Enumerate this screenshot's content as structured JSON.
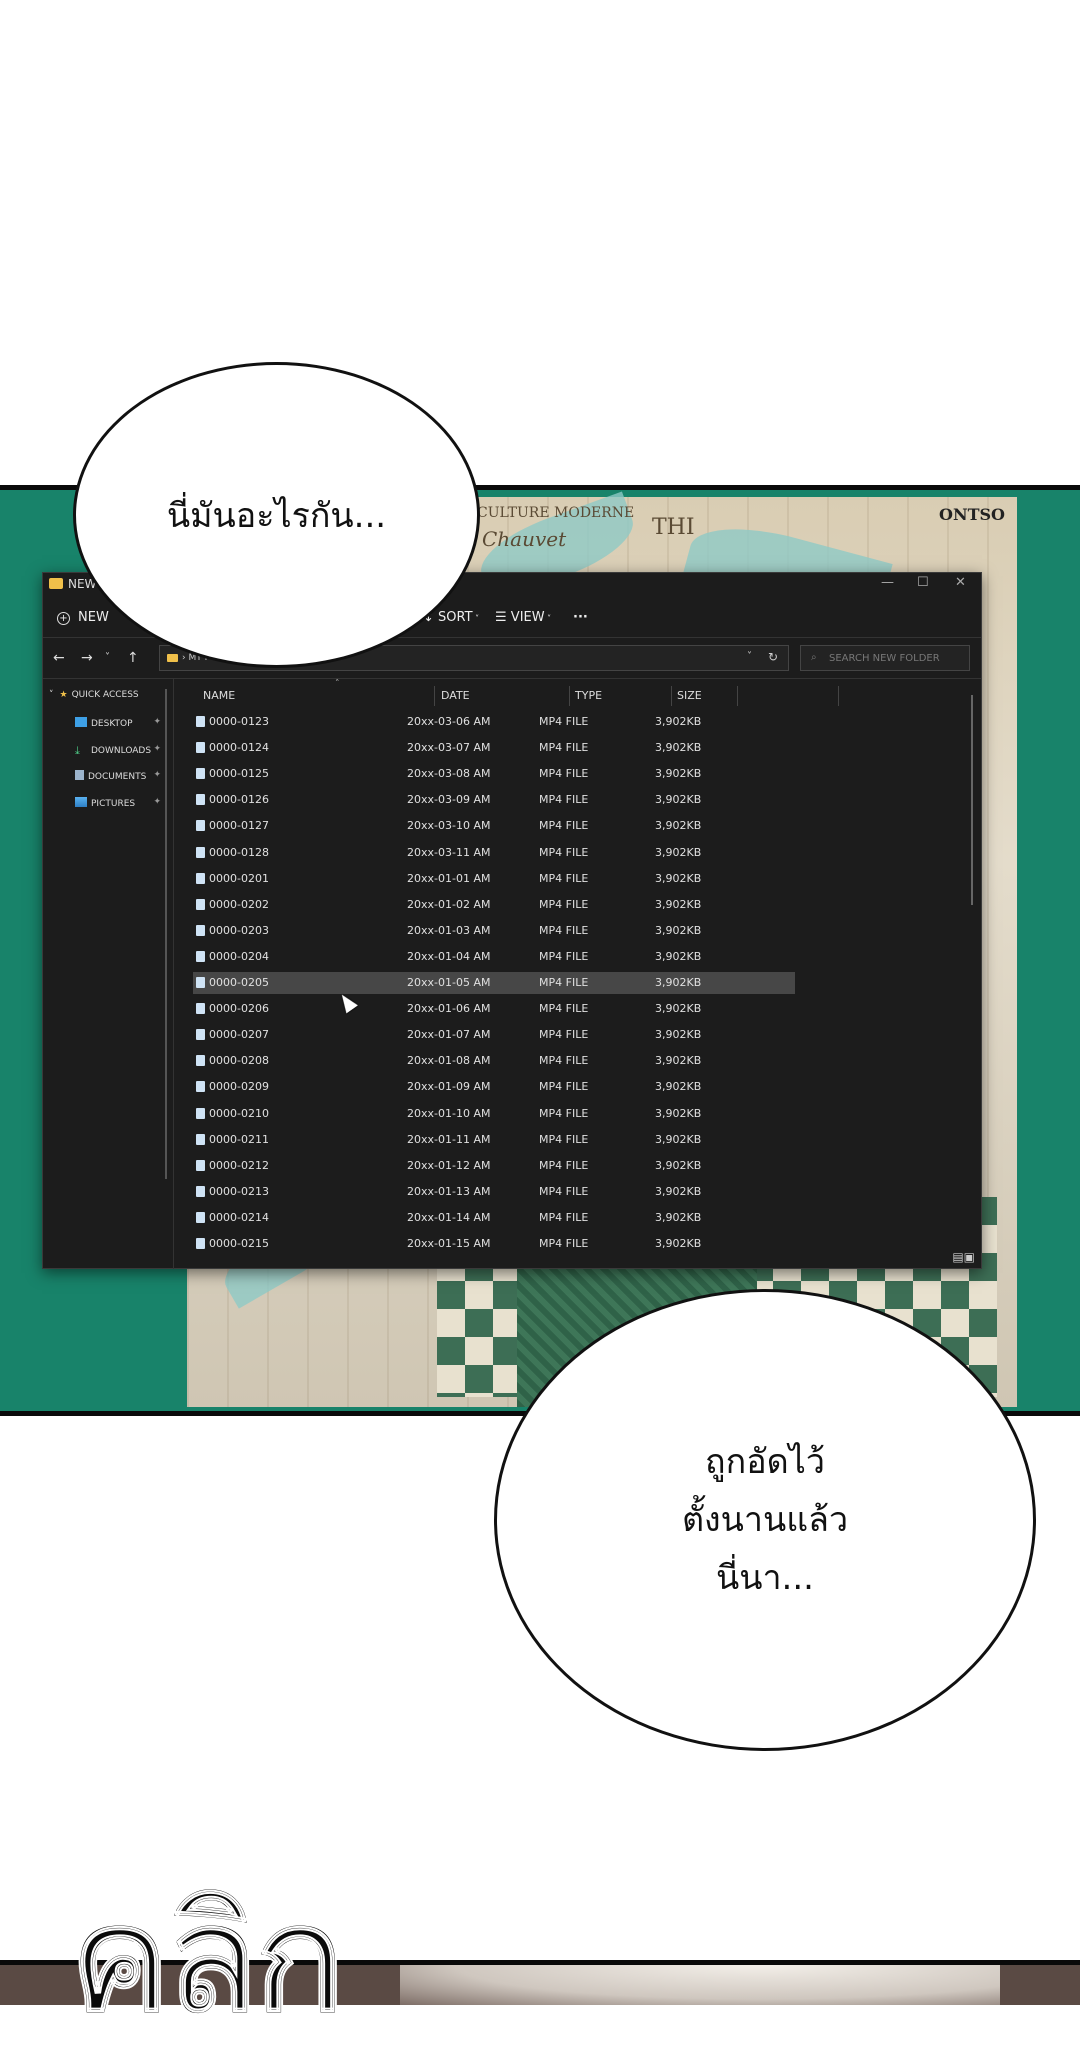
{
  "bubbles": {
    "top": "นี่มันอะไรกัน...",
    "bottom": "ถูกอัดไว้\nตั้งนานแล้ว\nนี่นา..."
  },
  "sfx": "คลิก",
  "background_art": {
    "text1": "CULTURE MODERNE",
    "text2": "Chauvet",
    "text3": "THI",
    "text4": "ONTSO"
  },
  "explorer": {
    "title": "NEW",
    "window_controls": [
      "—",
      "☐",
      "✕"
    ],
    "toolbar": {
      "new": "NEW",
      "sort": "SORT",
      "view": "VIEW",
      "more": "···"
    },
    "address": {
      "folder_icon": "folder-icon",
      "path": "› MY PC ›"
    },
    "search_placeholder": "SEARCH NEW FOLDER",
    "sidebar": {
      "quick_access": "QUICK ACCESS",
      "items": [
        "DESKTOP",
        "DOWNLOADS",
        "DOCUMENTS",
        "PICTURES"
      ]
    },
    "columns": [
      "NAME",
      "DATE",
      "TYPE",
      "SIZE"
    ],
    "selected_row": "0000-0205",
    "files": [
      {
        "name": "0000-0123",
        "date": "20xx-03-06 AM",
        "type": "MP4 FILE",
        "size": "3,902KB"
      },
      {
        "name": "0000-0124",
        "date": "20xx-03-07 AM",
        "type": "MP4 FILE",
        "size": "3,902KB"
      },
      {
        "name": "0000-0125",
        "date": "20xx-03-08 AM",
        "type": "MP4 FILE",
        "size": "3,902KB"
      },
      {
        "name": "0000-0126",
        "date": "20xx-03-09 AM",
        "type": "MP4 FILE",
        "size": "3,902KB"
      },
      {
        "name": "0000-0127",
        "date": "20xx-03-10 AM",
        "type": "MP4 FILE",
        "size": "3,902KB"
      },
      {
        "name": "0000-0128",
        "date": "20xx-03-11 AM",
        "type": "MP4 FILE",
        "size": "3,902KB"
      },
      {
        "name": "0000-0201",
        "date": "20xx-01-01 AM",
        "type": "MP4 FILE",
        "size": "3,902KB"
      },
      {
        "name": "0000-0202",
        "date": "20xx-01-02 AM",
        "type": "MP4 FILE",
        "size": "3,902KB"
      },
      {
        "name": "0000-0203",
        "date": "20xx-01-03 AM",
        "type": "MP4 FILE",
        "size": "3,902KB"
      },
      {
        "name": "0000-0204",
        "date": "20xx-01-04 AM",
        "type": "MP4 FILE",
        "size": "3,902KB"
      },
      {
        "name": "0000-0205",
        "date": "20xx-01-05 AM",
        "type": "MP4 FILE",
        "size": "3,902KB"
      },
      {
        "name": "0000-0206",
        "date": "20xx-01-06 AM",
        "type": "MP4 FILE",
        "size": "3,902KB"
      },
      {
        "name": "0000-0207",
        "date": "20xx-01-07 AM",
        "type": "MP4 FILE",
        "size": "3,902KB"
      },
      {
        "name": "0000-0208",
        "date": "20xx-01-08 AM",
        "type": "MP4 FILE",
        "size": "3,902KB"
      },
      {
        "name": "0000-0209",
        "date": "20xx-01-09 AM",
        "type": "MP4 FILE",
        "size": "3,902KB"
      },
      {
        "name": "0000-0210",
        "date": "20xx-01-10 AM",
        "type": "MP4 FILE",
        "size": "3,902KB"
      },
      {
        "name": "0000-0211",
        "date": "20xx-01-11 AM",
        "type": "MP4 FILE",
        "size": "3,902KB"
      },
      {
        "name": "0000-0212",
        "date": "20xx-01-12 AM",
        "type": "MP4 FILE",
        "size": "3,902KB"
      },
      {
        "name": "0000-0213",
        "date": "20xx-01-13 AM",
        "type": "MP4 FILE",
        "size": "3,902KB"
      },
      {
        "name": "0000-0214",
        "date": "20xx-01-14 AM",
        "type": "MP4 FILE",
        "size": "3,902KB"
      },
      {
        "name": "0000-0215",
        "date": "20xx-01-15 AM",
        "type": "MP4 FILE",
        "size": "3,902KB"
      }
    ]
  },
  "colors": {
    "panel_bg": "#18836a",
    "window_bg": "#1c1c1c",
    "selection": "#474747"
  }
}
